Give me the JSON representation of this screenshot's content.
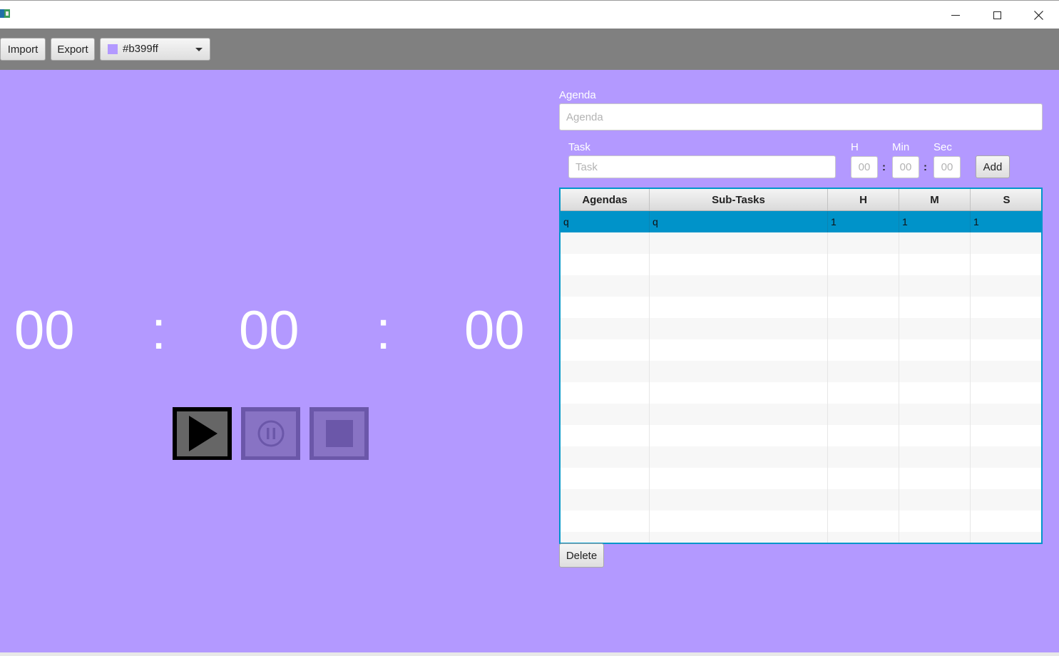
{
  "window": {
    "icon": "app-icon",
    "controls": [
      "minimize-icon",
      "maximize-icon",
      "close-icon"
    ]
  },
  "toolbar": {
    "import_label": "Import",
    "export_label": "Export",
    "color_value": "#b399ff",
    "color_icon": "chevron-down-icon"
  },
  "colors": {
    "background": "#b399ff",
    "toolbar": "#808080",
    "selection": "#0093c9"
  },
  "timer": {
    "hours": "00",
    "minutes": "00",
    "seconds": "00",
    "separator": ":"
  },
  "controls": {
    "play_icon": "play-icon",
    "pause_icon": "pause-icon",
    "stop_icon": "stop-icon"
  },
  "form": {
    "agenda_label": "Agenda",
    "agenda_placeholder": "Agenda",
    "task_label": "Task",
    "task_placeholder": "Task",
    "h_label": "H",
    "min_label": "Min",
    "sec_label": "Sec",
    "h_placeholder": "00",
    "min_placeholder": "00",
    "sec_placeholder": "00",
    "separator": ":",
    "add_label": "Add"
  },
  "table": {
    "columns": [
      "Agendas",
      "Sub-Tasks",
      "H",
      "M",
      "S"
    ],
    "rows": [
      [
        "q",
        "q",
        "1",
        "1",
        "1"
      ]
    ],
    "selected_row": 0
  },
  "delete_label": "Delete"
}
